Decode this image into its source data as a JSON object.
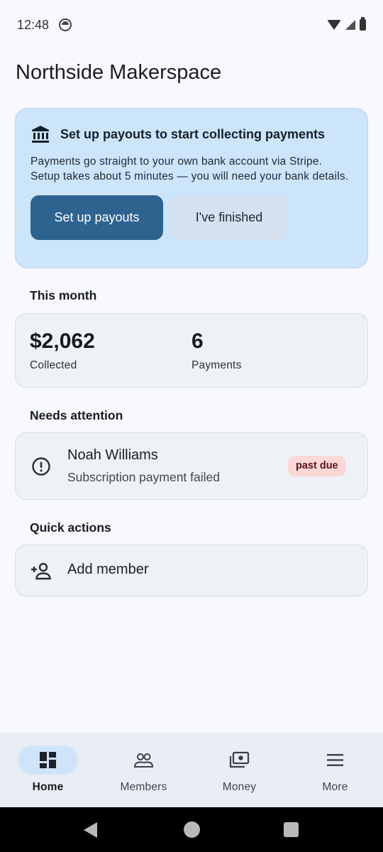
{
  "status_bar": {
    "time": "12:48"
  },
  "header": {
    "title": "Northside Makerspace"
  },
  "setup_card": {
    "icon": "bank-icon",
    "title": "Set up payouts to start collecting payments",
    "body": "Payments go straight to your own bank account via Stripe. Setup takes about 5 minutes — you will need your bank details.",
    "primary_label": "Set up payouts",
    "secondary_label": "I've finished"
  },
  "this_month": {
    "section_title": "This month",
    "collected_value": "$2,062",
    "collected_label": "Collected",
    "payments_value": "6",
    "payments_label": "Payments"
  },
  "needs_attention": {
    "section_title": "Needs attention",
    "items": [
      {
        "icon": "alert-circle-icon",
        "name": "Noah Williams",
        "detail": "Subscription payment failed",
        "badge": "past due",
        "badge_color": "#fcd8d6"
      }
    ]
  },
  "quick_actions": {
    "section_title": "Quick actions",
    "items": [
      {
        "icon": "add-person-icon",
        "label": "Add member"
      }
    ]
  },
  "bottom_nav": {
    "items": [
      {
        "icon": "dashboard-icon",
        "label": "Home",
        "active": true
      },
      {
        "icon": "group-icon",
        "label": "Members",
        "active": false
      },
      {
        "icon": "money-icon",
        "label": "Money",
        "active": false
      },
      {
        "icon": "menu-icon",
        "label": "More",
        "active": false
      }
    ]
  },
  "colors": {
    "accent": "#2e6390",
    "banner_background": "#cde5fb",
    "active_nav_pill": "#cfe4fb",
    "badge_background": "#fcd8d6"
  }
}
